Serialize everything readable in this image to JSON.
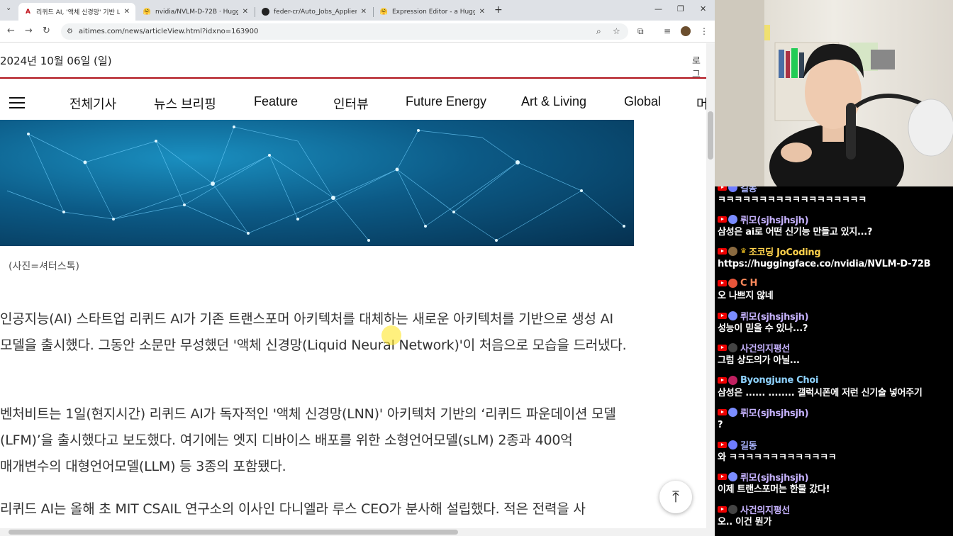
{
  "browser": {
    "tabs": [
      {
        "label": "리퀴드 AI, '액체 신경망' 기반 L",
        "favicon_color": "#c0121b",
        "active": true
      },
      {
        "label": "nvidia/NVLM-D-72B · Hugging",
        "favicon_color": "#f5c518",
        "active": false
      },
      {
        "label": "feder-cr/Auto_Jobs_Applier_AI",
        "favicon_color": "#222222",
        "active": false
      },
      {
        "label": "Expression Editor - a Hugging",
        "favicon_color": "#f5c518",
        "active": false
      }
    ],
    "url": "aitimes.com/news/articleView.html?idxno=163900"
  },
  "page": {
    "date": "2024년 10월 06일 (일)",
    "login": "로그",
    "nav": [
      "전체기사",
      "뉴스 브리핑",
      "Feature",
      "인터뷰",
      "Future Energy",
      "Art & Living",
      "Global",
      "머"
    ],
    "caption": "(사진=셔터스톡)",
    "paragraphs": [
      "인공지능(AI) 스타트업 리퀴드 AI가 기존 트랜스포머 아키텍처를 대체하는 새로운 아키텍처를 기반으로 생성 AI 모델을 출시했다. 그동안 소문만 무성했던 '액체 신경망(Liquid Neural Network)'이 처음으로 모습을 드러냈다.",
      "벤처비트는 1일(현지시간) 리퀴드 AI가 독자적인 '액체 신경망(LNN)' 아키텍처 기반의 ‘리퀴드 파운데이션 모델(LFM)’을 출시했다고 보도했다. 여기에는 엣지 디바이스 배포를 위한 소형언어모델(sLM) 2종과 400억 매개변수의 대형언어모델(LLM) 등 3종의 포함됐다.",
      "리퀴드 AI는 올해 초 MIT CSAIL 연구소의 이사인 다니엘라 루스 CEO가 분사해 설립했다. 적은 전력을 사"
    ],
    "back_to_top_icon": "arrow-up-icon"
  },
  "chat": {
    "messages": [
      {
        "user": "길동",
        "text": "ㅋㅋㅋㅋㅋㅋㅋㅋㅋㅋㅋㅋㅋㅋㅋㅋㅋㅋ",
        "color": "#aab4ff",
        "avatar_color": "#6f7cff"
      },
      {
        "user": "뤼모(sjhsjhsjh)",
        "text": "삼성은 ai로 어떤 신기능 만들고 있지...?",
        "color": "#c7b3ff",
        "avatar_color": "#7a8cff"
      },
      {
        "user": "조코딩 JoCoding",
        "text": "https://huggingface.co/nvidia/NVLM-D-72B",
        "color": "#ffd34d",
        "avatar_color": "#8a6a40"
      },
      {
        "user": "C H",
        "text": "오 나쁘지 않네",
        "color": "#ff8a5c",
        "avatar_color": "#e8553a"
      },
      {
        "user": "뤼모(sjhsjhsjh)",
        "text": "성능이 믿을 수 있나...?",
        "color": "#c7b3ff",
        "avatar_color": "#7a8cff"
      },
      {
        "user": "사건의지평선",
        "text": "그럼 상도의가 아닐...",
        "color": "#c7b3ff",
        "avatar_color": "#444444"
      },
      {
        "user": "Byongjune Choi",
        "text": "삼성은 ...... ........ 갤럭시폰에 저런 신기술 넣어주기",
        "color": "#8fd3ff",
        "avatar_color": "#c02060"
      },
      {
        "user": "뤼모(sjhsjhsjh)",
        "text": "?",
        "color": "#c7b3ff",
        "avatar_color": "#7a8cff"
      },
      {
        "user": "길동",
        "text": "와 ㅋㅋㅋㅋㅋㅋㅋㅋㅋㅋㅋㅋㅋ",
        "color": "#aab4ff",
        "avatar_color": "#6f7cff"
      },
      {
        "user": "뤼모(sjhsjhsjh)",
        "text": "이제 트랜스포머는 한물 갔다!",
        "color": "#c7b3ff",
        "avatar_color": "#7a8cff"
      },
      {
        "user": "사건의지평선",
        "text": "오.. 이건 뭔가",
        "color": "#c7b3ff",
        "avatar_color": "#444444"
      }
    ]
  }
}
